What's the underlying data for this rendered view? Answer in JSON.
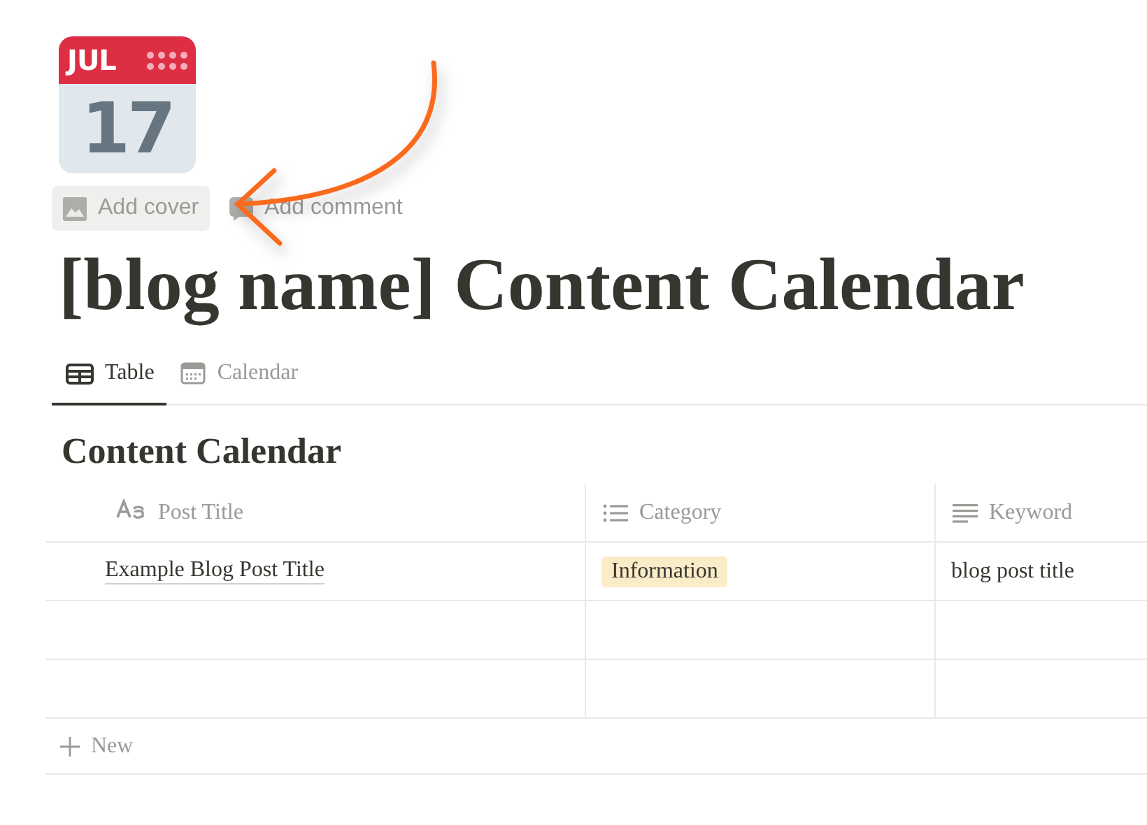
{
  "page_icon": {
    "month": "JUL",
    "day": "17"
  },
  "page_actions": [
    {
      "label": "Add cover",
      "kind": "cover",
      "hovered": true
    },
    {
      "label": "Add comment",
      "kind": "comment",
      "hovered": false
    }
  ],
  "title": "[blog name] Content Calendar",
  "views": [
    {
      "label": "Table",
      "kind": "table",
      "selected": true
    },
    {
      "label": "Calendar",
      "kind": "calendar",
      "selected": false
    }
  ],
  "database": {
    "title": "Content Calendar",
    "columns": [
      {
        "label": "Post Title",
        "kind": "title"
      },
      {
        "label": "Category",
        "kind": "select"
      },
      {
        "label": "Keyword",
        "kind": "text"
      }
    ],
    "rows": [
      {
        "post_title": "Example Blog Post Title",
        "category": {
          "label": "Information",
          "color": "#fbecc8"
        },
        "keyword": "blog post title"
      },
      {},
      {}
    ],
    "new_row_label": "New"
  }
}
